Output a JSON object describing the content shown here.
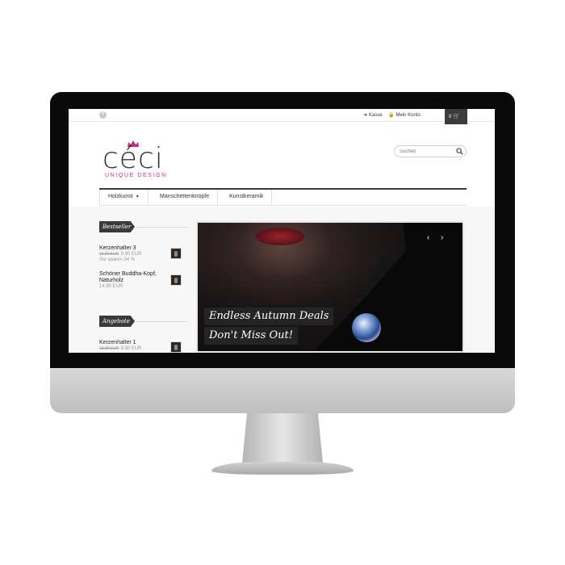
{
  "topbar": {
    "social_icon": "facebook-icon",
    "checkout_label": "Kasse",
    "account_label": "Mein Konto",
    "cart_count": "0"
  },
  "logo": {
    "word": "céci",
    "tagline": "UNIQUE DESIGN",
    "brand_color": "#c62d82"
  },
  "search": {
    "placeholder": "Suchen"
  },
  "nav": {
    "items": [
      {
        "label": "Holzkunst"
      },
      {
        "label": "Manschettenknöpfe"
      },
      {
        "label": "Kunstkeramik"
      }
    ]
  },
  "sidebar": {
    "bestseller": {
      "title": "Bestseller",
      "products": [
        {
          "name": "Kerzenhalter 3",
          "old_price": "13.90 EUR",
          "price": "9.90 EUR",
          "savings": "Sie sparen 34 %"
        },
        {
          "name_line1": "Schöner Buddha-Kopf,",
          "name_line2": "Naturholz",
          "price": "14.90 EUR"
        }
      ]
    },
    "offers": {
      "title": "Angebote",
      "products": [
        {
          "name": "Kerzenhalter 1",
          "old_price": "13.90 EUR",
          "price": "9.90 EUR"
        }
      ]
    }
  },
  "slider": {
    "caption_line1": "Endless Autumn Deals",
    "caption_line2": "Don't Miss Out!",
    "prev_icon": "chevron-left-icon",
    "next_icon": "chevron-right-icon"
  }
}
